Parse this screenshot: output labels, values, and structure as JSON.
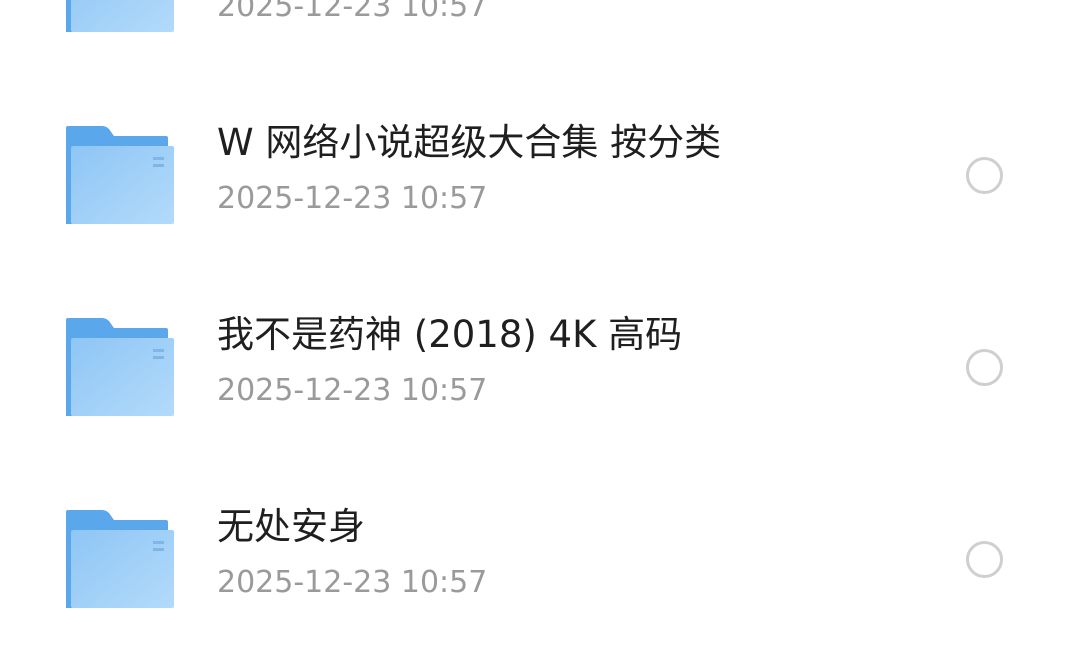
{
  "files": [
    {
      "name": "",
      "date": "2025-12-23 10:57",
      "icon": "folder-icon",
      "selected": false
    },
    {
      "name": "W 网络小说超级大合集 按分类",
      "date": "2025-12-23 10:57",
      "icon": "folder-icon",
      "selected": false
    },
    {
      "name": "我不是药神 (2018) 4K 高码",
      "date": "2025-12-23 10:57",
      "icon": "folder-icon",
      "selected": false
    },
    {
      "name": "无处安身",
      "date": "2025-12-23 10:57",
      "icon": "folder-icon",
      "selected": false
    }
  ],
  "colors": {
    "folder_back": "#5aa7ec",
    "folder_front_top": "#8ec6f4",
    "folder_front_bottom": "#b3dafb",
    "name_text": "#1f1f1f",
    "date_text": "#9a9a9a",
    "radio_border": "#cfcfcf"
  }
}
